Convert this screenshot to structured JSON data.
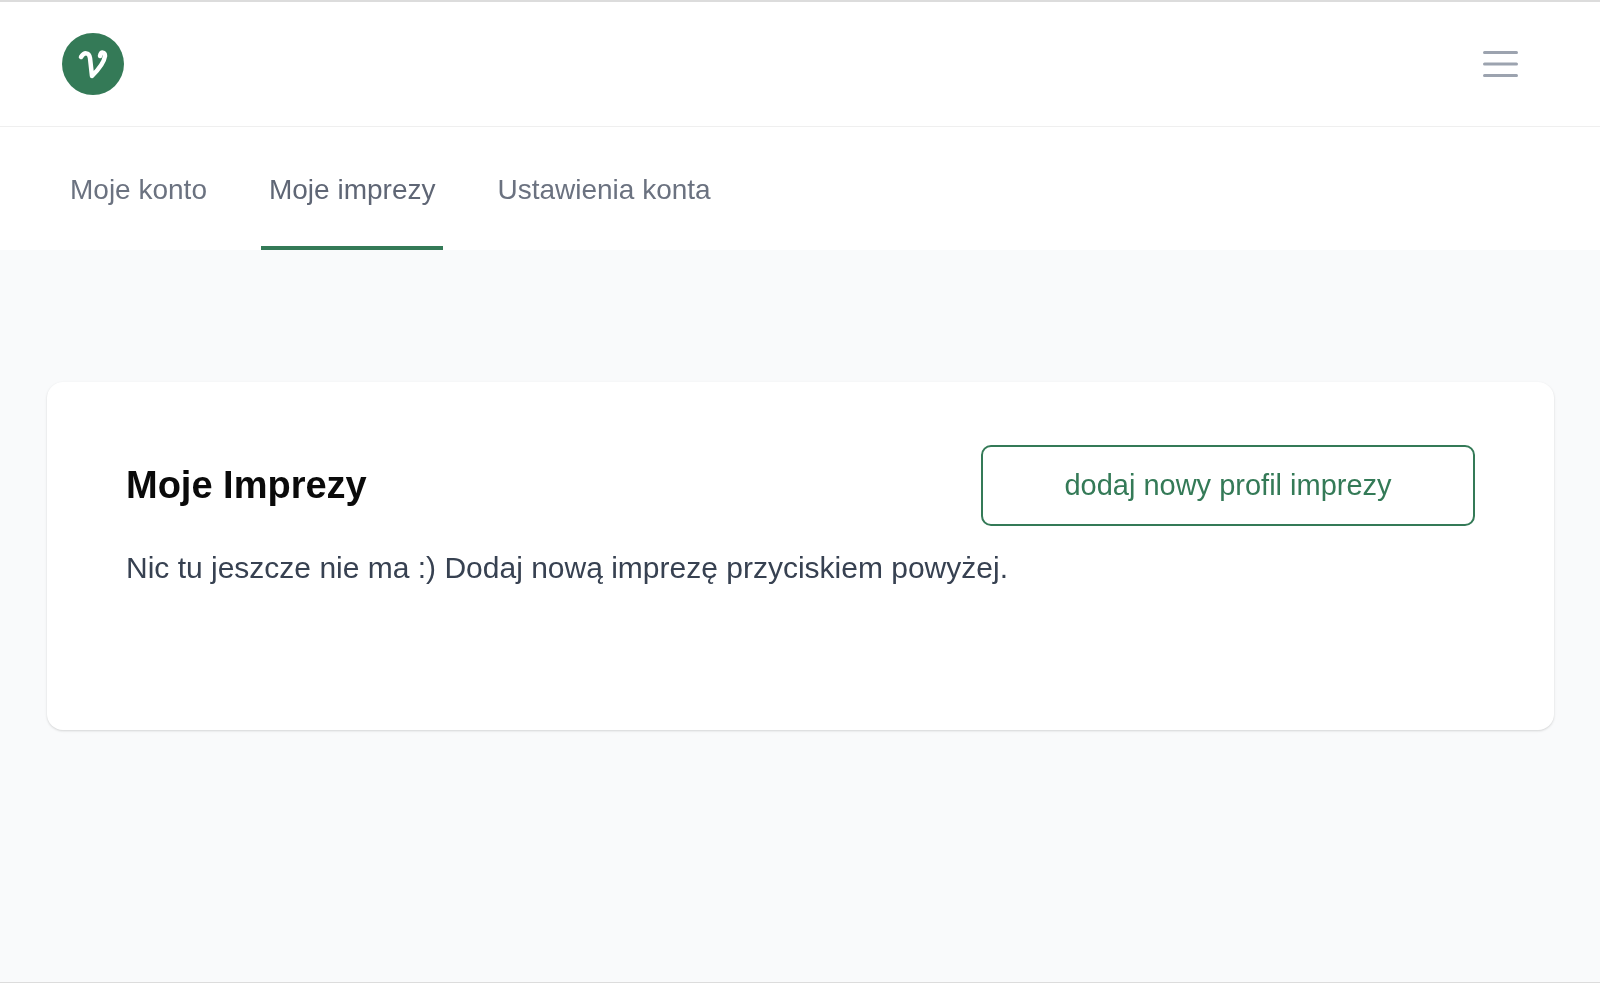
{
  "tabs": [
    {
      "label": "Moje konto",
      "selected": false
    },
    {
      "label": "Moje imprezy",
      "selected": true
    },
    {
      "label": "Ustawienia konta",
      "selected": false
    }
  ],
  "card": {
    "title": "Moje Imprezy",
    "action_button": "dodaj nowy profil imprezy",
    "empty_message": "Nic tu jeszcze nie ma :) Dodaj nową imprezę przyciskiem powyżej."
  }
}
